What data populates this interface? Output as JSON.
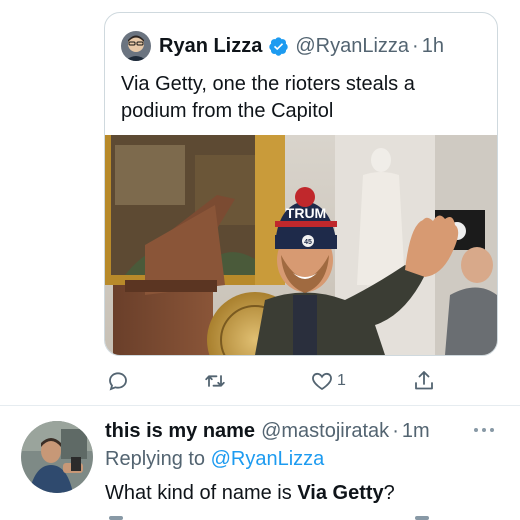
{
  "quoted_tweet": {
    "author_name": "Ryan Lizza",
    "author_handle": "@RyanLizza",
    "separator": "·",
    "time": "1h",
    "text": "Via Getty, one the rioters steals a podium from the Capitol",
    "verified": true,
    "avatar_icon": "person-avatar",
    "media": {
      "description_icon": "photo",
      "hat_text": "TRUM",
      "badge_text": "45"
    }
  },
  "actions": {
    "reply_icon": "reply-icon",
    "retweet_icon": "retweet-icon",
    "like_icon": "heart-icon",
    "like_count": "1",
    "share_icon": "share-icon"
  },
  "reply_tweet": {
    "author_name": "this is my name",
    "author_handle": "@mastojiratak",
    "separator": "·",
    "time": "1m",
    "replying_prefix": "Replying to",
    "replying_to": "@RyanLizza",
    "text_prefix": "What kind of name is ",
    "text_bold": "Via Getty",
    "text_suffix": "?"
  },
  "colors": {
    "accent": "#1d9bf0",
    "secondary_text": "#536471",
    "border": "#cfd9de"
  }
}
